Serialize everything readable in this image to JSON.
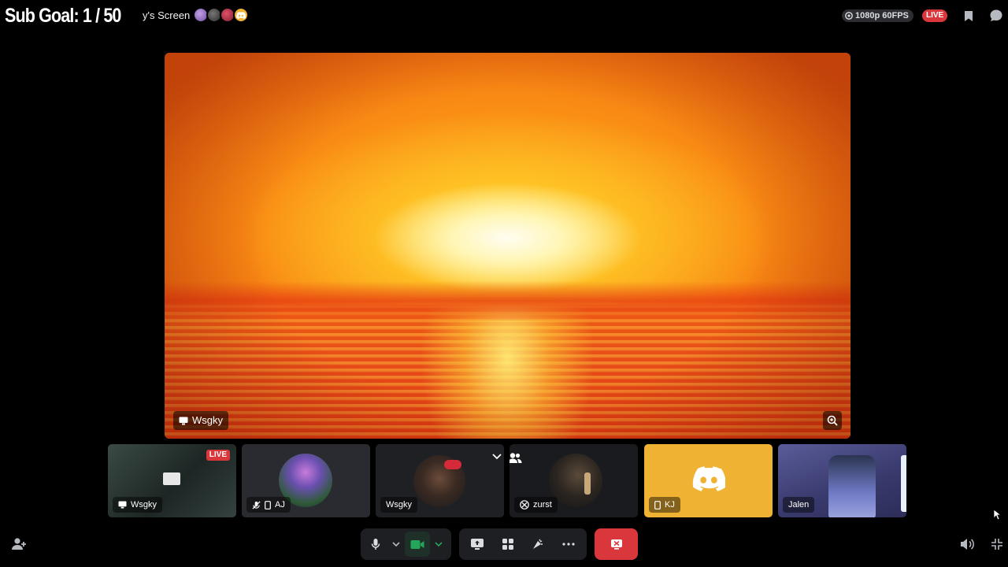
{
  "overlay": {
    "goal_text": "Sub Goal:  1 / 50"
  },
  "header": {
    "stream_title": "y's Screen",
    "viewer_avatar_colors": [
      "#8d6fb5",
      "#4a4a4a",
      "#b7324a",
      "#f0b232"
    ],
    "quality_label": "1080p 60FPS",
    "live_label": "LIVE"
  },
  "stage": {
    "streamer_name": "Wsgky"
  },
  "tiles": [
    {
      "name": "Wsgky",
      "live_label": "LIVE",
      "icon": "screen-icon"
    },
    {
      "name": "AJ",
      "icon": "mic-muted-icon"
    },
    {
      "name": "Wsgky",
      "icon": "none"
    },
    {
      "name": "zurst",
      "icon": "xbox-icon"
    },
    {
      "name": "KJ",
      "icon": "mobile-icon"
    },
    {
      "name": "Jalen",
      "icon": "none"
    }
  ],
  "colors": {
    "accent_red": "#da373c",
    "panel": "#1e1f22",
    "green": "#23a55a",
    "discord_yellow": "#f0b232"
  }
}
